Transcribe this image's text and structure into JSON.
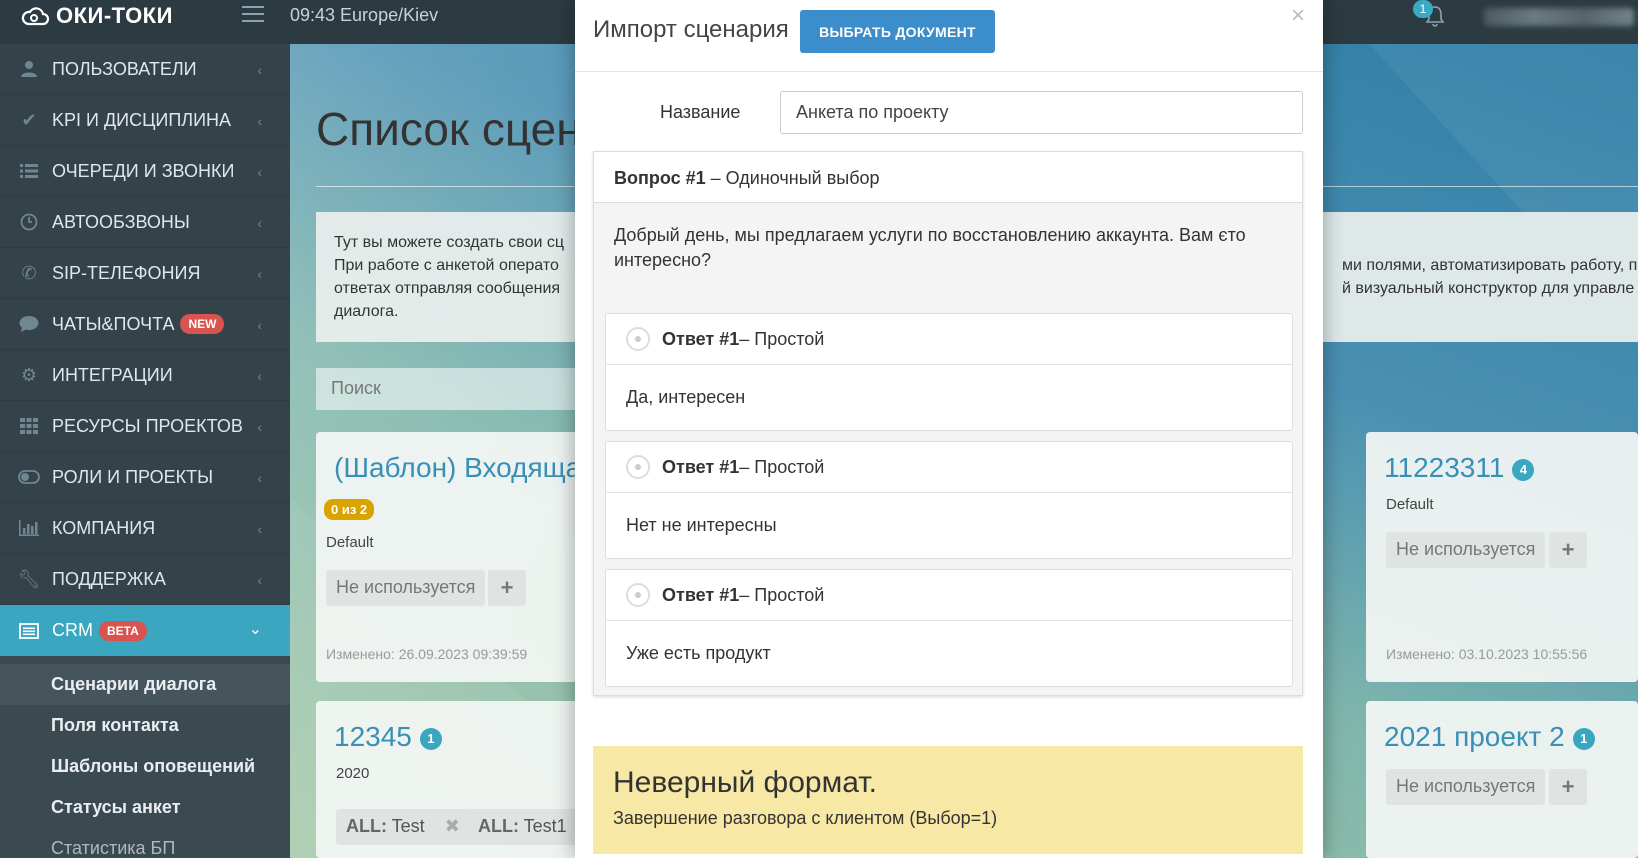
{
  "app": {
    "logo": "ОКИ-ТОКИ",
    "clock": "09:43  Europe/Kiev",
    "notifications": "1"
  },
  "sidebar": {
    "items": [
      {
        "label": "ПОЛЬЗОВАТЕЛИ",
        "icon": "user-icon"
      },
      {
        "label": "KPI И ДИСЦИПЛИНА",
        "icon": "check-icon"
      },
      {
        "label": "ОЧЕРЕДИ И ЗВОНКИ",
        "icon": "list-icon"
      },
      {
        "label": "АВТООБЗВОНЫ",
        "icon": "clock-icon"
      },
      {
        "label": "SIP-ТЕЛЕФОНИЯ",
        "icon": "phone-icon"
      },
      {
        "label": "ЧАТЫ&ПОЧТА",
        "icon": "chat-icon",
        "badge": "NEW"
      },
      {
        "label": "ИНТЕГРАЦИИ",
        "icon": "gears-icon"
      },
      {
        "label": "РЕСУРСЫ ПРОЕКТОВ",
        "icon": "grid-icon"
      },
      {
        "label": "РОЛИ И ПРОЕКТЫ",
        "icon": "toggle-icon"
      },
      {
        "label": "КОМПАНИЯ",
        "icon": "bar-chart-icon"
      },
      {
        "label": "ПОДДЕРЖКА",
        "icon": "wrench-icon"
      },
      {
        "label": "CRM",
        "icon": "table-icon",
        "badge": "BETA"
      }
    ],
    "submenu": [
      "Сценарии диалога",
      "Поля контакта",
      "Шаблоны оповещений",
      "Статусы анкет",
      "Статистика БП"
    ]
  },
  "page": {
    "title": "Список сцен",
    "info": {
      "line1": "Тут вы можете создать свои сц",
      "line2": "При работе с анкетой операто",
      "line3": "ответах отправляя сообщения",
      "line4": "диалога.",
      "line2_right": "ми полями, автоматизировать работу, п",
      "line3_right": "й визуальный конструктор для управле"
    },
    "search_placeholder": "Поиск",
    "cards": [
      {
        "name": "(Шаблон) Входяща",
        "tag": "0 из 2",
        "project": "Default",
        "status": "Не используется",
        "modified": "Изменено: 26.09.2023 09:39:59"
      },
      {
        "name": "11223311",
        "count": "4",
        "project": "Default",
        "status": "Не используется",
        "modified": "Изменено: 03.10.2023 10:55:56"
      },
      {
        "name": "12345",
        "count": "1",
        "project": "2020",
        "chips": [
          {
            "prefix": "ALL:",
            "value": "Test"
          },
          {
            "prefix": "ALL:",
            "value": "Test1"
          }
        ]
      },
      {
        "name": "2021 проект 2",
        "count": "1",
        "status": "Не используется"
      }
    ]
  },
  "modal": {
    "title": "Импорт сценария",
    "choose_button": "ВЫБРАТЬ ДОКУМЕНТ",
    "close": "×",
    "name_label": "Название",
    "name_value": "Анкета по проекту",
    "question": {
      "number": "Вопрос #1",
      "type": " – Одиночный выбор",
      "text": "Добрый день, мы предлагаем услуги по восстановлению аккаунта. Вам єто интересно?",
      "answers": [
        {
          "number": "Ответ #1",
          "type": " – Простой",
          "text": "Да, интересен"
        },
        {
          "number": "Ответ #1",
          "type": " – Простой",
          "text": "Нет не интересны"
        },
        {
          "number": "Ответ #1",
          "type": " – Простой",
          "text": "Уже есть продукт"
        }
      ]
    },
    "alert": {
      "title": "Неверный формат.",
      "text": "Завершение разговора с клиентом (Выбор=1)"
    }
  }
}
